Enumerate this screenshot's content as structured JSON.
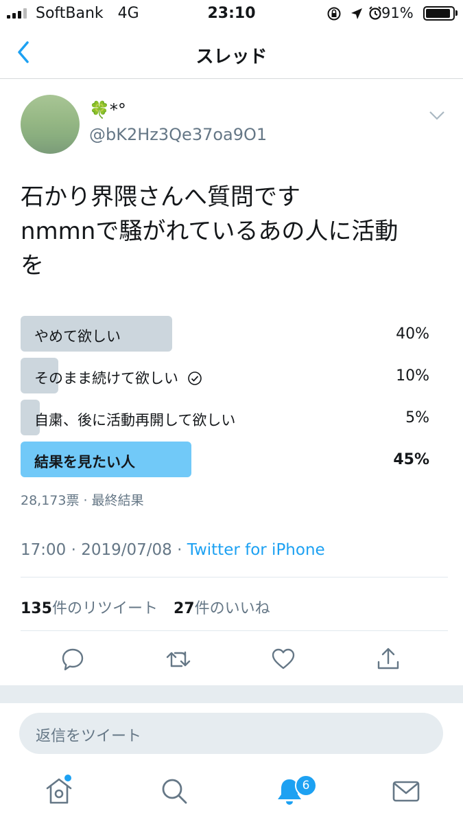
{
  "status_bar": {
    "carrier": "SoftBank",
    "network": "4G",
    "time": "23:10",
    "battery_percent_label": "91%",
    "battery_level": 0.91
  },
  "header": {
    "title": "スレッド"
  },
  "tweet": {
    "display_name": "🍀*°",
    "handle": "@bK2Hz3Qe37oa9O1",
    "text_line1": "石かり界隈さんへ質問です",
    "text_line2": "nmmnで騒がれているあの人に活動",
    "text_line3": "を",
    "poll": {
      "options": [
        {
          "label": "やめて欲しい",
          "percent_label": "40%",
          "value": 40,
          "winner": false,
          "voted": false
        },
        {
          "label": "そのまま続けて欲しい",
          "percent_label": "10%",
          "value": 10,
          "winner": false,
          "voted": true
        },
        {
          "label": "自粛、後に活動再開して欲しい",
          "percent_label": "5%",
          "value": 5,
          "winner": false,
          "voted": false
        },
        {
          "label": "結果を見たい人",
          "percent_label": "45%",
          "value": 45,
          "winner": true,
          "voted": false
        }
      ],
      "meta": "28,173票 · 最終結果"
    },
    "timestamp": "17:00 · 2019/07/08 · ",
    "via": "Twitter for iPhone",
    "retweet_count": "135",
    "retweet_label": "件のリツイート",
    "like_count": "27",
    "like_label": "件のいいね"
  },
  "reply": {
    "placeholder": "返信をツイート"
  },
  "tabbar": {
    "notification_badge": "6"
  },
  "colors": {
    "accent": "#1da1f2",
    "poll_bar": "#ccd6dd",
    "poll_winner": "#71c9f8",
    "secondary_text": "#657786"
  },
  "icons": [
    "back-chevron-icon",
    "dropdown-chevron-icon",
    "reply-icon",
    "retweet-icon",
    "like-icon",
    "share-icon",
    "home-icon",
    "search-icon",
    "notifications-icon",
    "messages-icon",
    "check-circle-icon"
  ]
}
